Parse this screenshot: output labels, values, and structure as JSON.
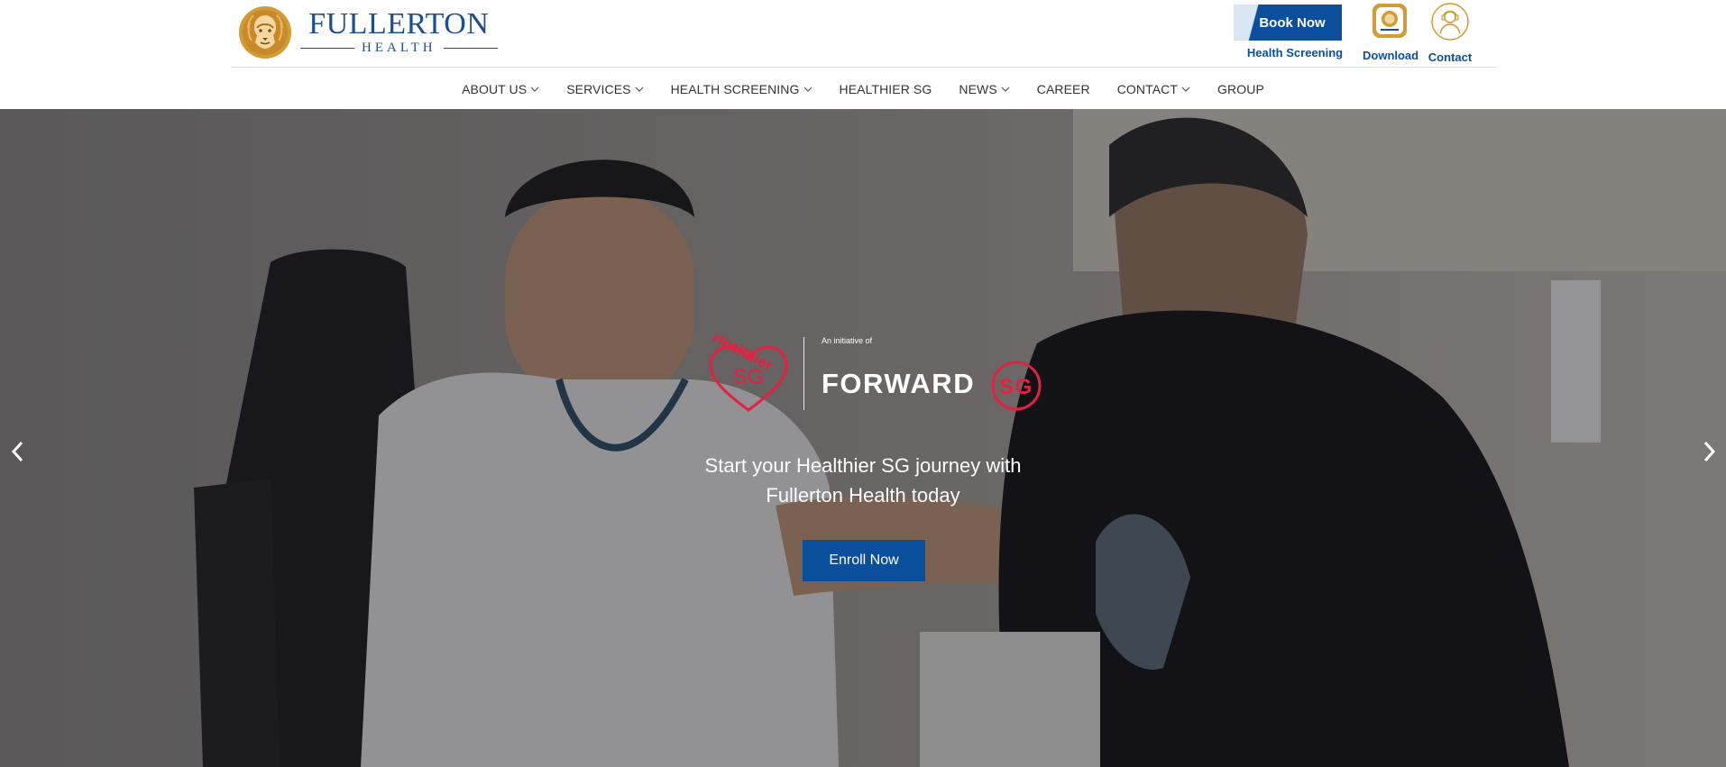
{
  "brand": {
    "name": "FULLERTON",
    "subtitle": "HEALTH",
    "primary_color": "#0b4f9c",
    "gold_color": "#c8922a"
  },
  "header": {
    "book_now_label": "Book Now",
    "book_caption": "Health Screening",
    "quick_links": [
      {
        "icon": "app-download-icon",
        "label": "Download"
      },
      {
        "icon": "contact-person-icon",
        "label": "Contact"
      }
    ]
  },
  "nav": {
    "items": [
      {
        "label": "ABOUT US",
        "has_dropdown": true
      },
      {
        "label": "SERVICES",
        "has_dropdown": true
      },
      {
        "label": "HEALTH SCREENING",
        "has_dropdown": true
      },
      {
        "label": "HEALTHIER SG",
        "has_dropdown": false
      },
      {
        "label": "NEWS",
        "has_dropdown": true
      },
      {
        "label": "CAREER",
        "has_dropdown": false
      },
      {
        "label": "CONTACT",
        "has_dropdown": true
      },
      {
        "label": "GROUP",
        "has_dropdown": false
      }
    ]
  },
  "hero": {
    "logo_healthier": "Healthier",
    "logo_sg": "SG",
    "initiative_text": "An initiative of",
    "forward_text": "FORWARD",
    "forward_sg": "SG",
    "headline_line1": "Start your Healthier SG journey with",
    "headline_line2": "Fullerton Health today",
    "cta_label": "Enroll Now",
    "accent_color": "#e5213f"
  }
}
